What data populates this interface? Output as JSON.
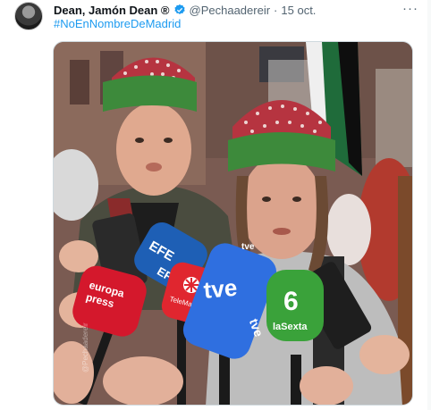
{
  "tweet": {
    "author_name": "Dean, Jamón Dean ®",
    "handle": "@Pechaadereir",
    "separator": "·",
    "date": "15 oct.",
    "more_label": "···",
    "hashtag": "#NoEnNombreDeMadrid"
  },
  "media": {
    "mic_labels": {
      "efe_line1": "EFE",
      "efe_line2": "EFE",
      "europa_press_line1": "europa",
      "europa_press_line2": "press",
      "telemadrid": "TeleMadrid",
      "tve_top": "tve",
      "tve_main": "tve",
      "tve_side": "tve",
      "lasexta_number": "6",
      "lasexta": "laSexta"
    },
    "watermark": "@Pechaadereir"
  },
  "colors": {
    "link": "#1d9bf0",
    "muted": "#536471",
    "verified": "#1d9bf0"
  }
}
